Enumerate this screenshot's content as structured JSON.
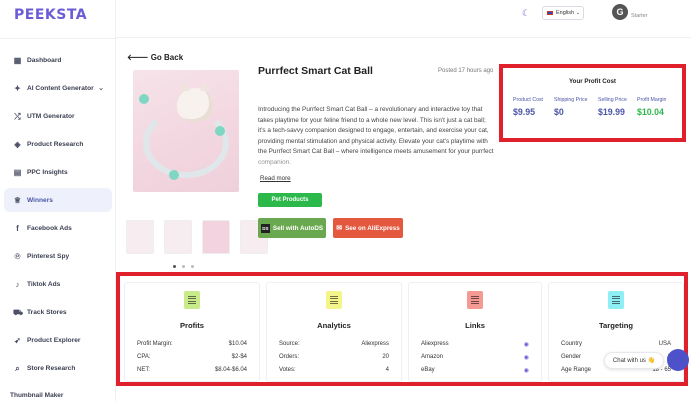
{
  "app": {
    "logo": "PEEKSTA"
  },
  "sidebar": {
    "items": [
      {
        "label": "Dashboard",
        "icon": "dashboard-icon"
      },
      {
        "label": "AI Content Generator",
        "icon": "ai-icon"
      },
      {
        "label": "UTM Generator",
        "icon": "shuffle-icon"
      },
      {
        "label": "Product Research",
        "icon": "cube-icon"
      },
      {
        "label": "PPC Insights",
        "icon": "document-icon"
      },
      {
        "label": "Winners",
        "icon": "trophy-icon"
      },
      {
        "label": "Facebook Ads",
        "icon": "facebook-icon"
      },
      {
        "label": "Pinterest Spy",
        "icon": "pinterest-icon"
      },
      {
        "label": "Tiktok Ads",
        "icon": "tiktok-icon"
      },
      {
        "label": "Track Stores",
        "icon": "truck-icon"
      },
      {
        "label": "Product Explorer",
        "icon": "rocket-icon"
      },
      {
        "label": "Store Research",
        "icon": "search-icon"
      }
    ],
    "footer_item": "Thumbnail Maker"
  },
  "topbar": {
    "language": "English",
    "user": "Starter"
  },
  "product": {
    "back_label": "Go Back",
    "title": "Purrfect Smart Cat Ball",
    "posted": "Posted 17 hours ago",
    "description": "Introducing the Purrfect Smart Cat Ball – a revolutionary and interactive toy that takes playtime for your feline friend to a whole new level. This isn't just a cat ball; it's a tech-savvy companion designed to engage, entertain, and exercise your cat, providing mental stimulation and physical activity. Elevate your cat's playtime with the Purrfect Smart Cat Ball – where intelligence meets amusement for your purrfect companion.",
    "read_more": "Read more",
    "category_tag": "Pet Products",
    "autods_button": "Sell with AutoDS",
    "aliexpress_button": "See on AliExpress"
  },
  "profit": {
    "title": "Your Profit Cost",
    "product_cost_label": "Product Cost",
    "product_cost": "$9.95",
    "shipping_label": "Shipping Price",
    "shipping": "$0",
    "selling_label": "Selling Price",
    "selling": "$19.99",
    "margin_label": "Profit Margin",
    "margin": "$10.04"
  },
  "cards": {
    "profits": {
      "title": "Profits",
      "rows": [
        {
          "label": "Profit Margin:",
          "value": "$10.04"
        },
        {
          "label": "CPA:",
          "value": "$2-$4"
        },
        {
          "label": "NET:",
          "value": "$8.04-$6.04"
        }
      ]
    },
    "analytics": {
      "title": "Analytics",
      "rows": [
        {
          "label": "Source:",
          "value": "Aliexpress"
        },
        {
          "label": "Orders:",
          "value": "20"
        },
        {
          "label": "Votes:",
          "value": "4"
        }
      ]
    },
    "links": {
      "title": "Links",
      "rows": [
        {
          "label": "Aliexpress"
        },
        {
          "label": "Amazon"
        },
        {
          "label": "eBay"
        }
      ]
    },
    "targeting": {
      "title": "Targeting",
      "rows": [
        {
          "label": "Country",
          "value": "USA"
        },
        {
          "label": "Gender",
          "value": "A"
        },
        {
          "label": "Age Range",
          "value": "18 - 65"
        }
      ]
    }
  },
  "chat": {
    "label": "Chat with us 👋"
  },
  "colors": {
    "brand": "#6b5cd6",
    "highlight": "#e0202a",
    "green": "#2db84c",
    "aliexpress": "#e4583f"
  }
}
